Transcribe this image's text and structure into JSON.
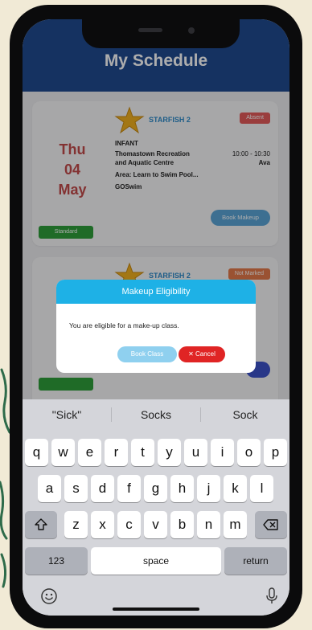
{
  "app": {
    "title": "My Schedule"
  },
  "cards": [
    {
      "date": {
        "day": "Thu",
        "num": "04",
        "month": "May"
      },
      "badge": "Standard",
      "class_name": "STARFISH 2",
      "status": "Absent",
      "level": "INFANT",
      "venue_line1": "Thomastown Recreation",
      "venue_line2": "and Aquatic Centre",
      "time": "10:00 - 10:30",
      "instructor": "Ava",
      "area": "Area: Learn to Swim Pool...",
      "provider": "GOSwim",
      "action": "Book Makeup",
      "status_color": "#e35a5a"
    },
    {
      "class_name": "STARFISH 2",
      "status": "Not Marked",
      "status_color": "#e47a4a"
    }
  ],
  "dialog": {
    "title": "Makeup Eligibility",
    "message": "You are eligible for a make-up class.",
    "book_label": "Book Class",
    "cancel_label": "✕  Cancel"
  },
  "keyboard": {
    "suggestions": [
      "\"Sick\"",
      "Socks",
      "Sock"
    ],
    "row1": [
      "q",
      "w",
      "e",
      "r",
      "t",
      "y",
      "u",
      "i",
      "o",
      "p"
    ],
    "row2": [
      "a",
      "s",
      "d",
      "f",
      "g",
      "h",
      "j",
      "k",
      "l"
    ],
    "row3": [
      "z",
      "x",
      "c",
      "v",
      "b",
      "n",
      "m"
    ],
    "numbers_label": "123",
    "space_label": "space",
    "return_label": "return",
    "icons": {
      "shift": "shift-icon",
      "delete": "backspace-icon",
      "emoji": "emoji-icon",
      "mic": "microphone-icon"
    }
  },
  "colors": {
    "header": "#1f4a90",
    "accent": "#1eb1e6",
    "danger": "#e02424"
  }
}
